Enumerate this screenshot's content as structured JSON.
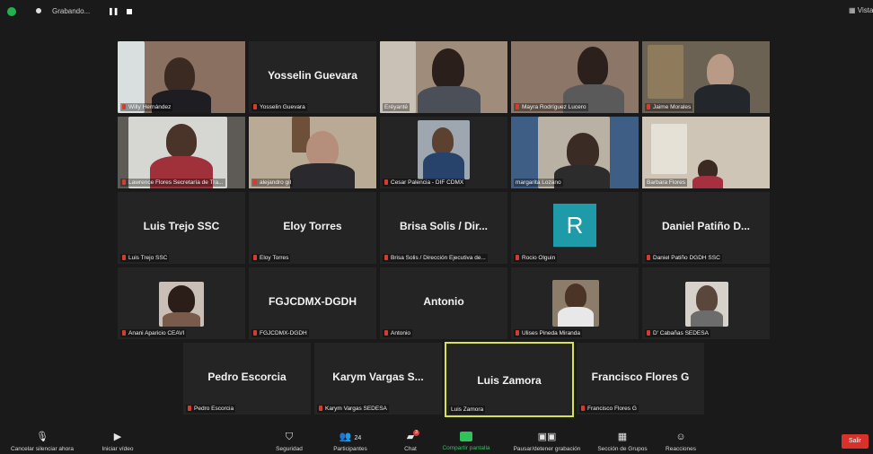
{
  "topbar": {
    "recording_text": "Grabando...",
    "pause_glyph": "❚❚",
    "view_label": "Vista"
  },
  "participants": [
    {
      "big": "",
      "label": "Willy Hernández"
    },
    {
      "big": "Yosselin Guevara",
      "label": "Yosselin Guevara"
    },
    {
      "big": "",
      "label": "Eréyanté"
    },
    {
      "big": "",
      "label": "Mayra Rodríguez Lucero"
    },
    {
      "big": "",
      "label": "Jaime Morales"
    },
    {
      "big": "",
      "label": "Lawrence Flores Secretaría de Tra..."
    },
    {
      "big": "",
      "label": "alejandro gil"
    },
    {
      "big": "",
      "label": "Cesar Palencia - DIF CDMX"
    },
    {
      "big": "",
      "label": "margarita Lozano"
    },
    {
      "big": "",
      "label": "Barbara Flores"
    },
    {
      "big": "Luis Trejo SSC",
      "label": "Luis Trejo SSC"
    },
    {
      "big": "Eloy Torres",
      "label": "Eloy Torres"
    },
    {
      "big": "Brisa Solis / Dir...",
      "label": "Brisa Solis / Dirección Ejecutiva de..."
    },
    {
      "big": "",
      "label": "Rocio Olguin",
      "avatar": "R"
    },
    {
      "big": "Daniel Patiño D...",
      "label": "Daniel Patiño DGDH SSC"
    },
    {
      "big": "",
      "label": "Anani Aparicio CEAVI"
    },
    {
      "big": "FGJCDMX-DGDH",
      "label": "FGJCDMX-DGDH"
    },
    {
      "big": "Antonio",
      "label": "Antonio"
    },
    {
      "big": "",
      "label": "Ulises Pineda Miranda"
    },
    {
      "big": "",
      "label": "D' Cabañas SEDESA"
    },
    {
      "big": "Pedro Escorcia",
      "label": "Pedro Escorcia"
    },
    {
      "big": "Karym Vargas S...",
      "label": "Karym Vargas SEDESA"
    },
    {
      "big": "Luis Zamora",
      "label": "Luis Zamora"
    },
    {
      "big": "Francisco Flores G",
      "label": "Francisco Flores G"
    }
  ],
  "toolbar": {
    "mute": "Cancelar silenciar ahora",
    "video": "Iniciar vídeo",
    "security": "Seguridad",
    "participants": "Participantes",
    "participants_count": "24",
    "chat": "Chat",
    "chat_badge": "3",
    "share": "Compartir pantalla",
    "record": "Pausar/detener grabación",
    "rooms": "Sección de Grupos",
    "reactions": "Reacciones",
    "leave": "Salir"
  }
}
